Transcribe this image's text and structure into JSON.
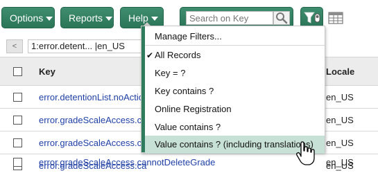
{
  "toolbar": {
    "options_label": "Options",
    "reports_label": "Reports",
    "help_label": "Help",
    "search_placeholder": "Search on Key",
    "accent": "#2f7b5e"
  },
  "crumb": {
    "back_label": "<",
    "value": "1:error.detent... |en_US"
  },
  "table": {
    "headers": {
      "key": "Key",
      "locale": "Locale"
    },
    "rows": [
      {
        "key": "error.detentionList.noAction",
        "locale": "en_US"
      },
      {
        "key": "error.gradeScaleAccess.ca",
        "locale": "en_US"
      },
      {
        "key": "error.gradeScaleAccess.ca",
        "locale": "en_US"
      },
      {
        "key": "error.gradeScaleAccess.ca",
        "locale": "en_US"
      },
      {
        "key": "error.gradeScaleAccess.cannotDeleteGrade",
        "locale": "en_US"
      }
    ]
  },
  "menu": {
    "items": [
      {
        "label": "Manage Filters..."
      },
      {
        "label": "All Records",
        "checked": true
      },
      {
        "label": "Key = ?"
      },
      {
        "label": "Key contains ?"
      },
      {
        "label": "Online Registration"
      },
      {
        "label": "Value contains ?"
      },
      {
        "label": "Value contains ? (including translations)",
        "highlighted": true
      }
    ],
    "highlight_color": "#c8e1d7"
  }
}
